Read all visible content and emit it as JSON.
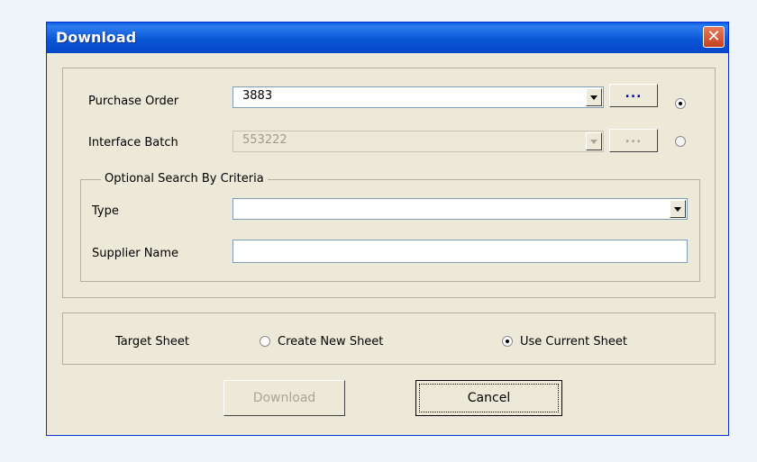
{
  "window": {
    "title": "Download",
    "close_glyph": "✕"
  },
  "purchase_order": {
    "label": "Purchase Order",
    "value": "3883",
    "browse": "...",
    "selected": true
  },
  "interface_batch": {
    "label": "Interface Batch",
    "value": "553222",
    "browse": "...",
    "selected": false
  },
  "criteria": {
    "title": "Optional Search By Criteria",
    "type_label": "Type",
    "type_value": "",
    "supplier_label": "Supplier Name",
    "supplier_value": ""
  },
  "target": {
    "label": "Target Sheet",
    "options": [
      {
        "label": "Create New Sheet",
        "selected": false
      },
      {
        "label": "Use Current Sheet",
        "selected": true
      }
    ]
  },
  "buttons": {
    "download": "Download",
    "cancel": "Cancel"
  },
  "colors": {
    "titlebar": "#0a58d6",
    "dialog_bg": "#ece9d8",
    "close": "#c4401d",
    "browse_active": "#0000cc"
  }
}
